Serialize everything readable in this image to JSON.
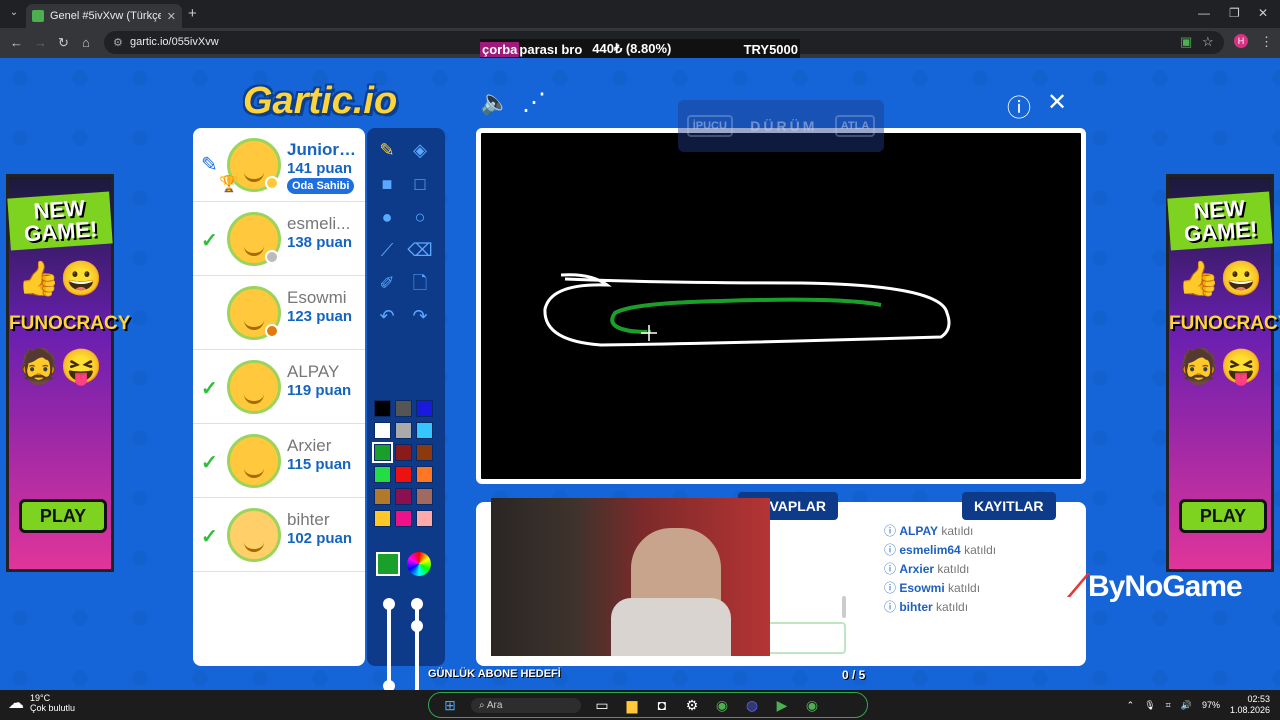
{
  "browser": {
    "tab_title": "Genel #5ivXvw (Türkçe) - Gartic",
    "url": "gartic.io/055ivXvw",
    "profile_initial": "H"
  },
  "donation_bar": {
    "message": "çorba",
    "message_rest": " parası bro",
    "amount": "440₺ (8.80%)",
    "goal": "TRY5000"
  },
  "game": {
    "logo": "Gartic.io",
    "status_left": "İPUCU",
    "status_center": "DÜRÜM",
    "status_right": "ATLA",
    "players": [
      {
        "name": "JuniorP...",
        "points": "141 puan",
        "drawing": true,
        "badge": "Oda Sahibi",
        "dot": "#ffc83d",
        "rank": "1"
      },
      {
        "name": "esmeli...",
        "points": "138 puan",
        "guessed": true,
        "dot": "#bbbbbb"
      },
      {
        "name": "Esowmi",
        "points": "123 puan",
        "dot": "#e07b10"
      },
      {
        "name": "ALPAY",
        "points": "119 puan",
        "guessed": true
      },
      {
        "name": "Arxier",
        "points": "115 puan",
        "guessed": true
      },
      {
        "name": "bihter",
        "points": "102 puan",
        "guessed": true
      }
    ],
    "palette": [
      "#000000",
      "#555555",
      "#1a1adf",
      "#ffffff",
      "#aaaaaa",
      "#35c6ff",
      "#1aa02a",
      "#8b1a1a",
      "#8b3a10",
      "#22dd44",
      "#ee1111",
      "#ff7722",
      "#b07a2a",
      "#8a1050",
      "#a06a60",
      "#ffc828",
      "#ee1188",
      "#ffaaaa"
    ],
    "current_color": "#1aa02a",
    "tabs": {
      "answers": "CEVAPLAR",
      "logs": "KAYITLAR"
    },
    "logs": [
      {
        "user": "ALPAY",
        "action": "katıldı"
      },
      {
        "user": "esmelim64",
        "action": "katıldı"
      },
      {
        "user": "Arxier",
        "action": "katıldı"
      },
      {
        "user": "Esowmi",
        "action": "katıldı"
      },
      {
        "user": "bihter",
        "action": "katıldı"
      }
    ]
  },
  "ads": {
    "new_game": "NEW GAME!",
    "brand": "FUNOCRACY",
    "play": "PLAY"
  },
  "overlay": {
    "sponsor_by": "By",
    "sponsor_rest": "NoGame",
    "sub_goal_label": "GÜNLÜK ABONE HEDEFİ",
    "sub_goal_count": "0 / 5"
  },
  "taskbar": {
    "temp": "19°C",
    "weather": "Çok bulutlu",
    "search": "Ara",
    "battery": "97%",
    "time": "02:53",
    "date": "1.08.2026"
  }
}
